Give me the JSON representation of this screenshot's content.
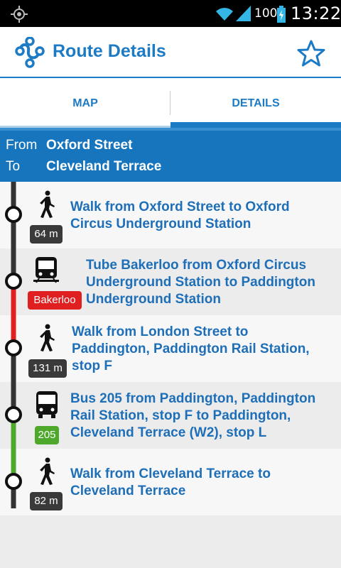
{
  "status_bar": {
    "battery": "100",
    "time": "13:22"
  },
  "action_bar": {
    "title": "Route Details",
    "icons": [
      "route-logo-icon",
      "star-icon"
    ]
  },
  "tabs": [
    {
      "label": "MAP",
      "selected": false
    },
    {
      "label": "DETAILS",
      "selected": true
    }
  ],
  "route": {
    "from_label": "From",
    "from_value": "Oxford Street",
    "to_label": "To",
    "to_value": "Cleveland Terrace"
  },
  "steps": [
    {
      "mode": "walk",
      "icon": "walk-icon",
      "badge": "64 m",
      "badge_color": "#3a3a3a",
      "line1": "Walk from Oxford Street to Oxford",
      "line2": "Circus Underground Station",
      "line3": ""
    },
    {
      "mode": "tube",
      "icon": "train-icon",
      "badge": "Bakerloo",
      "badge_color": "#e02020",
      "line1": "Tube Bakerloo from Oxford Circus",
      "line2": "Underground Station to Paddington",
      "line3": "Underground Station"
    },
    {
      "mode": "walk",
      "icon": "walk-icon",
      "badge": "131 m",
      "badge_color": "#3a3a3a",
      "line1": "Walk from London Street to",
      "line2": "Paddington, Paddington Rail Station,",
      "line3": "stop F"
    },
    {
      "mode": "bus",
      "icon": "bus-icon",
      "badge": "205",
      "badge_color": "#4ea82b",
      "line1": "Bus 205 from Paddington, Paddington",
      "line2": "Rail Station, stop F to Paddington,",
      "line3": "Cleveland Terrace (W2), stop L"
    },
    {
      "mode": "walk",
      "icon": "walk-icon",
      "badge": "82 m",
      "badge_color": "#3a3a3a",
      "line1": "Walk from Cleveland Terrace to",
      "line2": "Cleveland Terrace",
      "line3": ""
    }
  ],
  "colors": {
    "accent": "#1c7bc4",
    "walk_line": "#333333",
    "tube_line": "#e02020",
    "bus_line": "#4ea82b"
  }
}
